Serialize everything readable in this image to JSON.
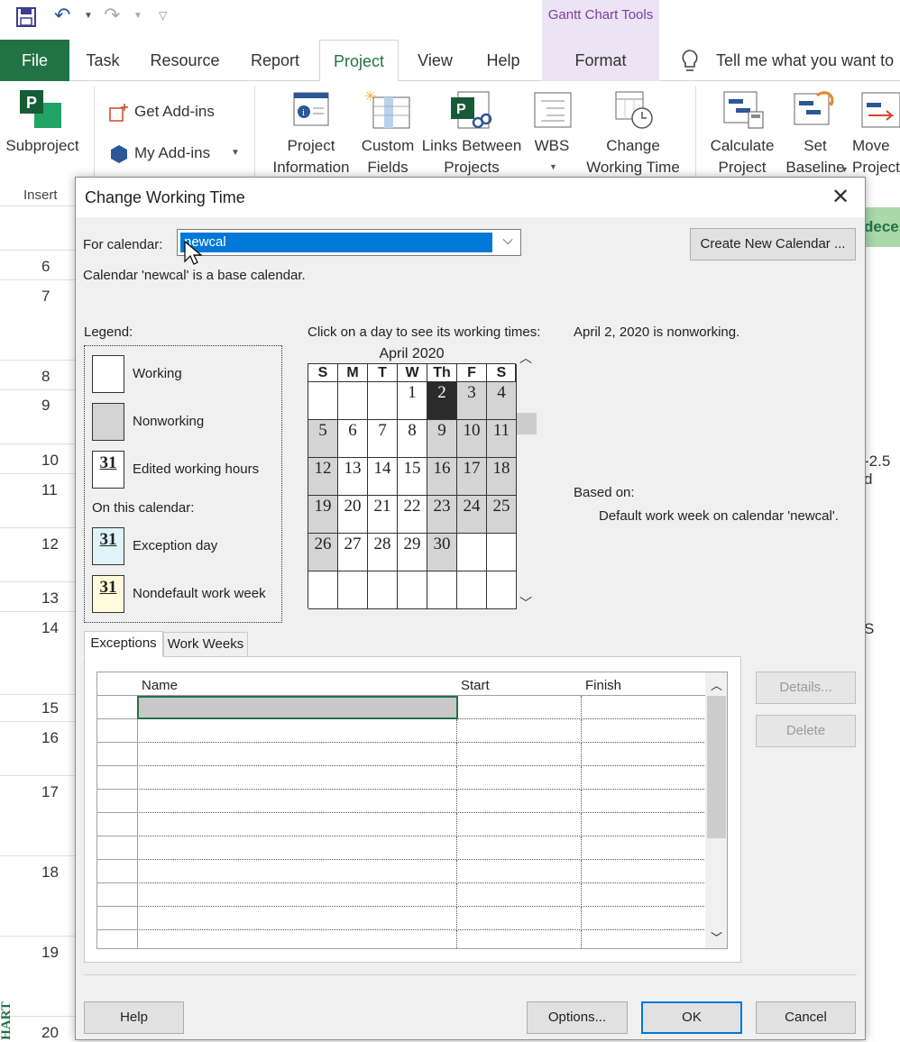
{
  "app": {
    "contextual_group": "Gantt Chart Tools",
    "tabs": [
      "File",
      "Task",
      "Resource",
      "Report",
      "Project",
      "View",
      "Help",
      "Format"
    ],
    "tell_me": "Tell me what you want to",
    "ribbon": {
      "subproject": "Subproject",
      "get_addins": "Get Add-ins",
      "my_addins": "My Add-ins",
      "project_info": [
        "Project",
        "Information"
      ],
      "custom_fields": [
        "Custom",
        "Fields"
      ],
      "links_between": [
        "Links Between",
        "Projects"
      ],
      "wbs": "WBS",
      "change_working_time": [
        "Change",
        "Working Time"
      ],
      "calculate_project": [
        "Calculate",
        "Project"
      ],
      "set_baseline": [
        "Set",
        "Baseline"
      ],
      "move_project": [
        "Move",
        "Project"
      ],
      "insert": "Insert"
    },
    "row_numbers": [
      "6",
      "7",
      "8",
      "9",
      "10",
      "11",
      "12",
      "13",
      "14",
      "15",
      "16",
      "17",
      "18",
      "19",
      "20"
    ],
    "background_fragments": {
      "deces": "deces",
      "minus25": "-2.5 d",
      "s": "S",
      "chart": "HART"
    }
  },
  "dialog": {
    "title": "Change Working Time",
    "for_calendar_label": "For calendar:",
    "calendar_value": "newcal",
    "base_calendar_text": "Calendar 'newcal' is a base calendar.",
    "create_new_calendar": "Create New Calendar ...",
    "legend_label": "Legend:",
    "legend": {
      "working": "Working",
      "nonworking": "Nonworking",
      "edited": "Edited working hours",
      "on_this_calendar": "On this calendar:",
      "exception_day": "Exception day",
      "nondefault_week": "Nondefault work week",
      "sample_day": "31"
    },
    "click_day_label": "Click on a day to see its working times:",
    "day_status": "April 2, 2020 is nonworking.",
    "based_on_label": "Based on:",
    "based_on_value": "Default work week on calendar 'newcal'.",
    "month_title": "April 2020",
    "weekdays": [
      "S",
      "M",
      "T",
      "W",
      "Th",
      "F",
      "S"
    ],
    "weeks": [
      [
        "",
        "",
        "",
        "1",
        "2",
        "3",
        "4"
      ],
      [
        "5",
        "6",
        "7",
        "8",
        "9",
        "10",
        "11"
      ],
      [
        "12",
        "13",
        "14",
        "15",
        "16",
        "17",
        "18"
      ],
      [
        "19",
        "20",
        "21",
        "22",
        "23",
        "24",
        "25"
      ],
      [
        "26",
        "27",
        "28",
        "29",
        "30",
        "",
        ""
      ],
      [
        "",
        "",
        "",
        "",
        "",
        "",
        ""
      ]
    ],
    "selected_day": "2",
    "tabs": [
      "Exceptions",
      "Work Weeks"
    ],
    "grid_columns": [
      "Name",
      "Start",
      "Finish"
    ],
    "buttons": {
      "details": "Details...",
      "delete": "Delete",
      "help": "Help",
      "options": "Options...",
      "ok": "OK",
      "cancel": "Cancel"
    },
    "colors": {
      "nonworking": "#d4d4d4",
      "selected": "#2b2b2b",
      "exception": "#dff3f8",
      "nondefault": "#fffbdc",
      "accent": "#217346"
    }
  }
}
